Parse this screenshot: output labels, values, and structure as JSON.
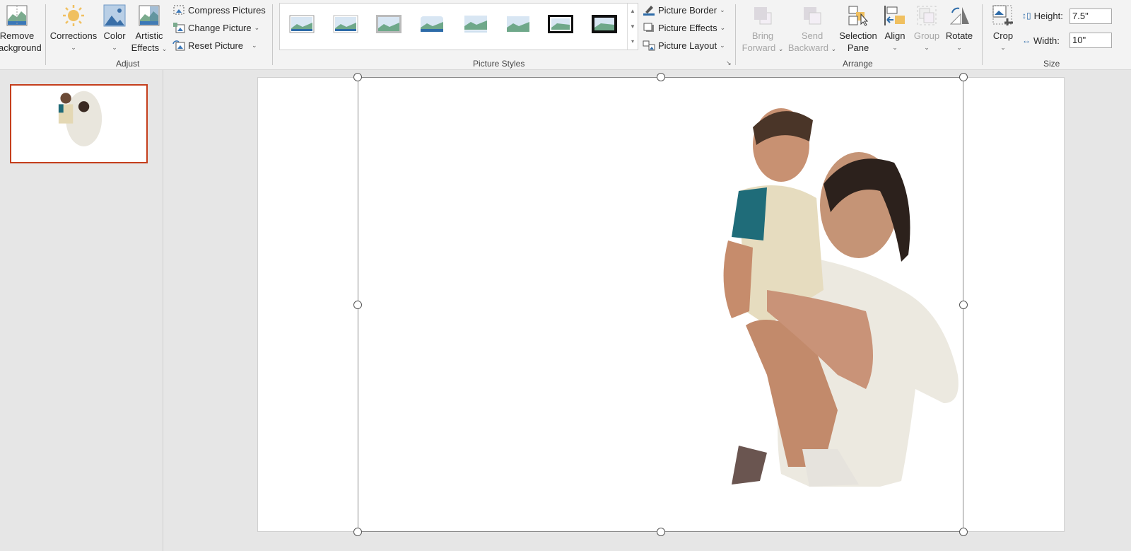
{
  "ribbon": {
    "adjust": {
      "remove_background": "Remove\nBackground",
      "corrections": "Corrections",
      "color": "Color",
      "artistic_effects_1": "Artistic",
      "artistic_effects_2": "Effects",
      "compress": "Compress Pictures",
      "change": "Change Picture",
      "reset": "Reset Picture",
      "group_label": "Adjust"
    },
    "styles": {
      "picture_border": "Picture Border",
      "picture_effects": "Picture Effects",
      "picture_layout": "Picture Layout",
      "group_label": "Picture Styles",
      "style_count": 8
    },
    "arrange": {
      "bring_1": "Bring",
      "bring_2": "Forward",
      "send_1": "Send",
      "send_2": "Backward",
      "selection_1": "Selection",
      "selection_2": "Pane",
      "align": "Align",
      "group": "Group",
      "rotate": "Rotate",
      "group_label": "Arrange"
    },
    "size": {
      "crop": "Crop",
      "height_label": "Height:",
      "height_value": "7.5\"",
      "width_label": "Width:",
      "width_value": "10\"",
      "group_label": "Size"
    }
  },
  "colors": {
    "accent": "#c43e1c",
    "ribbon_bg": "#f3f3f3",
    "workspace": "#e6e6e6"
  }
}
